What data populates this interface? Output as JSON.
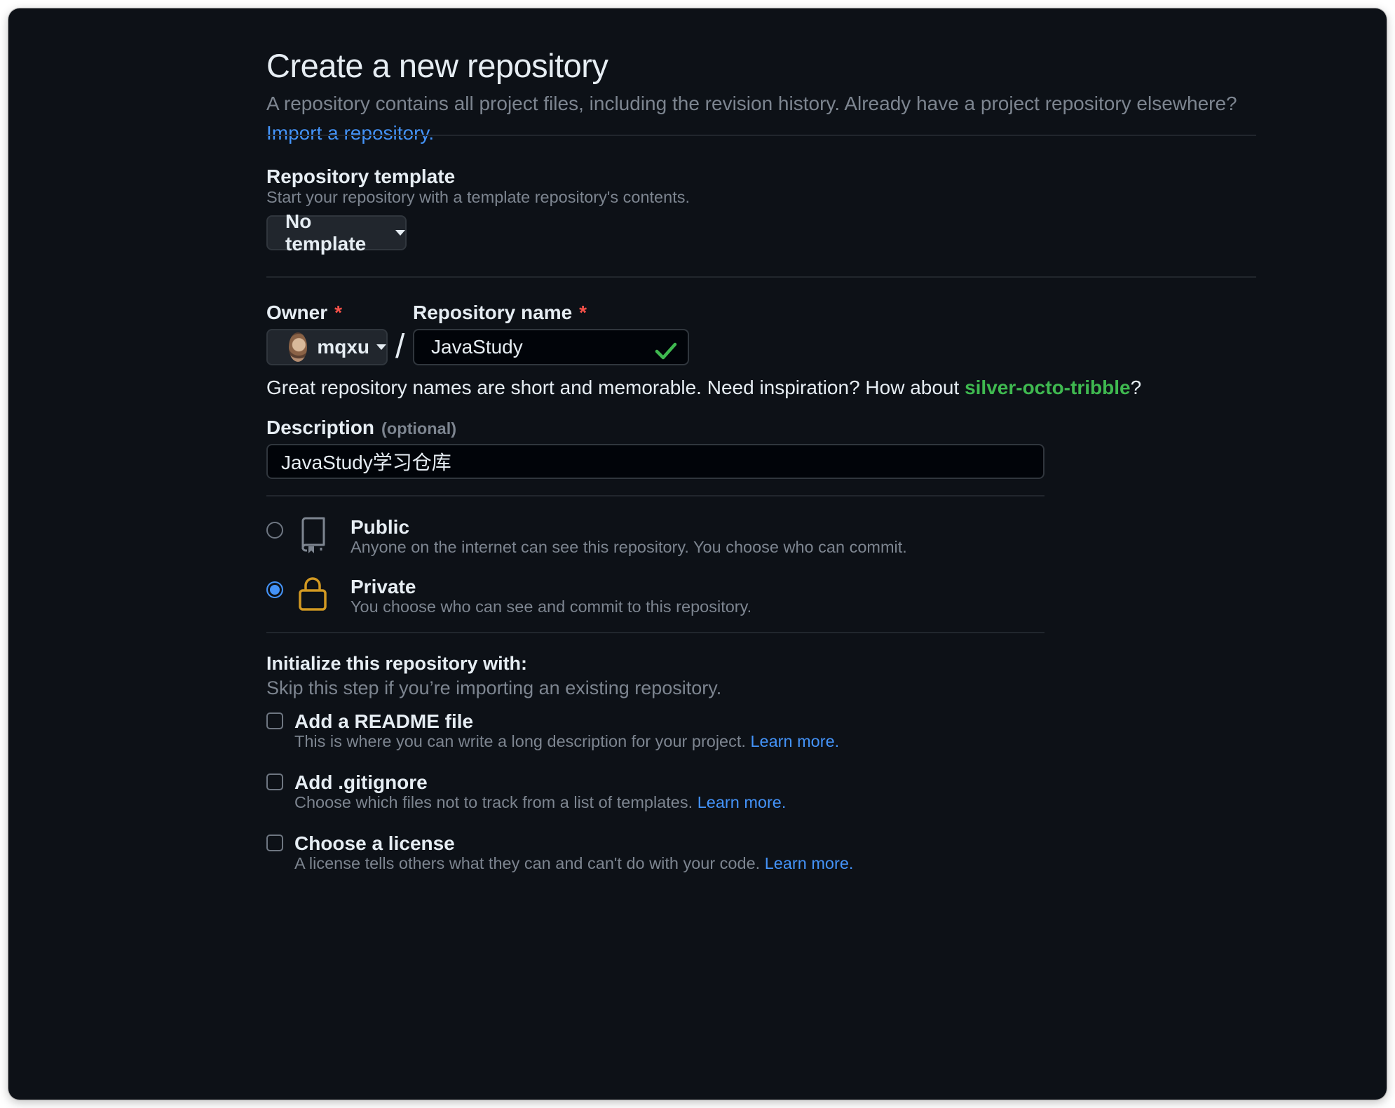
{
  "header": {
    "title": "Create a new repository",
    "intro_text": "A repository contains all project files, including the revision history. Already have a project repository elsewhere?",
    "import_link": "Import a repository."
  },
  "template": {
    "title": "Repository template",
    "subtitle": "Start your repository with a template repository's contents.",
    "button_label": "No template"
  },
  "owner": {
    "label": "Owner",
    "required_mark": "*",
    "value": "mqxu"
  },
  "repo_name": {
    "label": "Repository name",
    "required_mark": "*",
    "separator": "/",
    "value": "JavaStudy",
    "hint_prefix": "Great repository names are short and memorable. Need inspiration? How about",
    "suggestion": "silver-octo-tribble",
    "hint_suffix": "?"
  },
  "description": {
    "label": "Description",
    "optional": "(optional)",
    "value": "JavaStudy学习仓库"
  },
  "visibility": {
    "options": [
      {
        "title": "Public",
        "desc": "Anyone on the internet can see this repository. You choose who can commit.",
        "selected": false,
        "icon": "repo-icon"
      },
      {
        "title": "Private",
        "desc": "You choose who can see and commit to this repository.",
        "selected": true,
        "icon": "lock-icon"
      }
    ]
  },
  "initialize": {
    "title": "Initialize this repository with:",
    "subtitle": "Skip this step if you’re importing an existing repository.",
    "items": [
      {
        "title": "Add a README file",
        "desc": "This is where you can write a long description for your project.",
        "link": "Learn more.",
        "checked": false
      },
      {
        "title": "Add .gitignore",
        "desc": "Choose which files not to track from a list of templates.",
        "link": "Learn more.",
        "checked": false
      },
      {
        "title": "Choose a license",
        "desc": "A license tells others what they can and can't do with your code.",
        "link": "Learn more.",
        "checked": false
      }
    ]
  },
  "colors": {
    "background": "#0d1117",
    "link": "#4493f8",
    "success": "#3fb950",
    "required": "#f85149",
    "lock": "#d29922"
  }
}
